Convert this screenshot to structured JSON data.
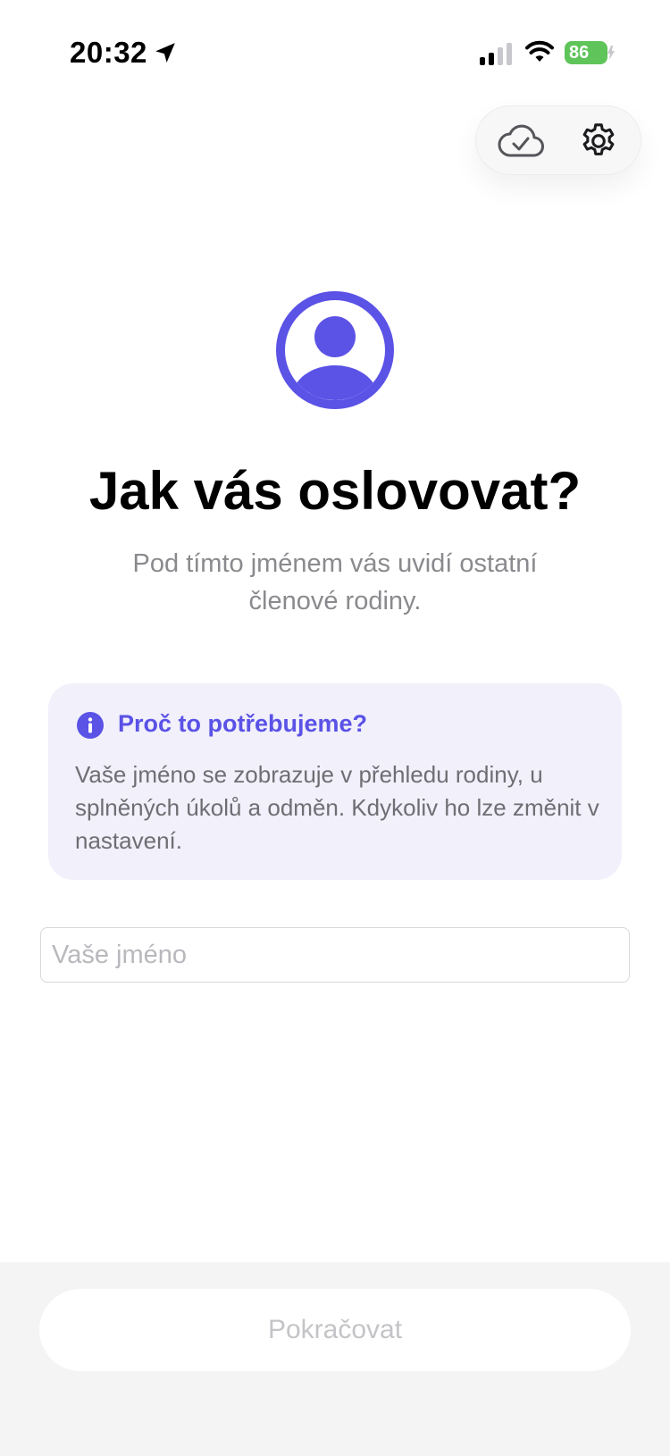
{
  "status_bar": {
    "time": "20:32",
    "battery": "86"
  },
  "icons": {
    "cloud": "cloud-check-icon",
    "settings": "gear-icon",
    "avatar": "person-circle-icon",
    "info": "info-icon"
  },
  "onboarding": {
    "title": "Jak vás oslovovat?",
    "subtitle": "Pod tímto jménem vás uvidí ostatní členové rodiny."
  },
  "info_card": {
    "title": "Proč to potřebujeme?",
    "text": "Vaše jméno se zobrazuje v přehledu rodiny, u splněných úkolů a odměn. Kdykoliv ho lze změnit v nastavení."
  },
  "name_input": {
    "value": "",
    "placeholder": "Vaše jméno"
  },
  "footer": {
    "continue_label": "Pokračovat"
  },
  "colors": {
    "accent": "#5b52e6",
    "info_bg": "#f1f0fb",
    "battery": "#5fc45a"
  }
}
